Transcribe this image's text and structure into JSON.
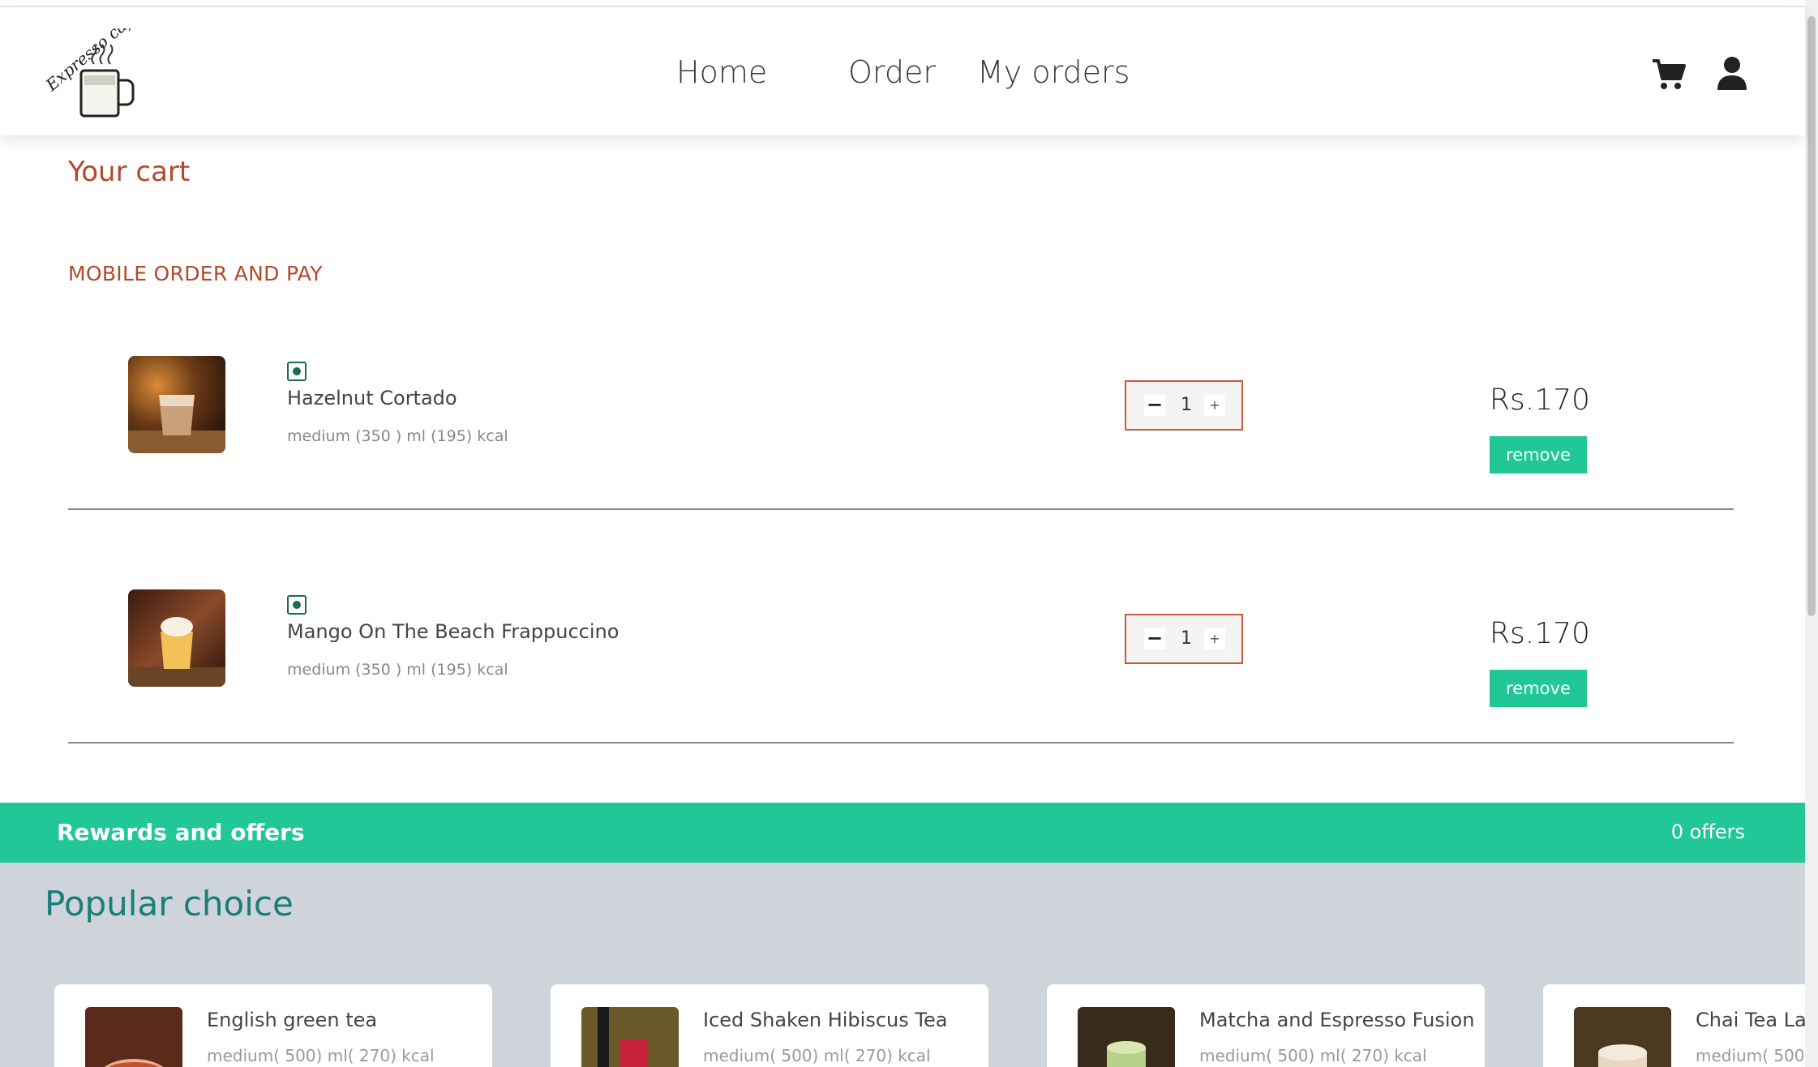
{
  "header": {
    "logo_text": "Expresso cafe",
    "nav": [
      "Home",
      "Order",
      "My orders"
    ],
    "icons": [
      "cart-icon",
      "user-icon"
    ]
  },
  "cart": {
    "title": "Your cart",
    "section_label": "MOBILE ORDER AND PAY",
    "items": [
      {
        "name": "Hazelnut Cortado",
        "meta": "medium (350 ) ml (195) kcal",
        "quantity": "1",
        "minus": "−",
        "plus": "+",
        "price": "Rs.170",
        "remove_label": "remove"
      },
      {
        "name": "Mango On The Beach Frappuccino",
        "meta": "medium (350 ) ml (195) kcal",
        "quantity": "1",
        "minus": "−",
        "plus": "+",
        "price": "Rs.170",
        "remove_label": "remove"
      }
    ]
  },
  "rewards": {
    "title": "Rewards and offers",
    "count": "0 offers"
  },
  "popular": {
    "title": "Popular choice",
    "items": [
      {
        "name": "English green tea",
        "meta": "medium( 500) ml( 270) kcal"
      },
      {
        "name": "Iced Shaken Hibiscus Tea",
        "meta": "medium( 500) ml( 270) kcal"
      },
      {
        "name": "Matcha and Espresso Fusion",
        "meta": "medium( 500) ml( 270) kcal"
      },
      {
        "name": "Chai Tea La",
        "meta": "medium( 500"
      }
    ]
  },
  "colors": {
    "accent_red": "#b2492b",
    "accent_green": "#21c796",
    "popular_title": "#177e7a",
    "popular_bg": "#cfd3da"
  }
}
